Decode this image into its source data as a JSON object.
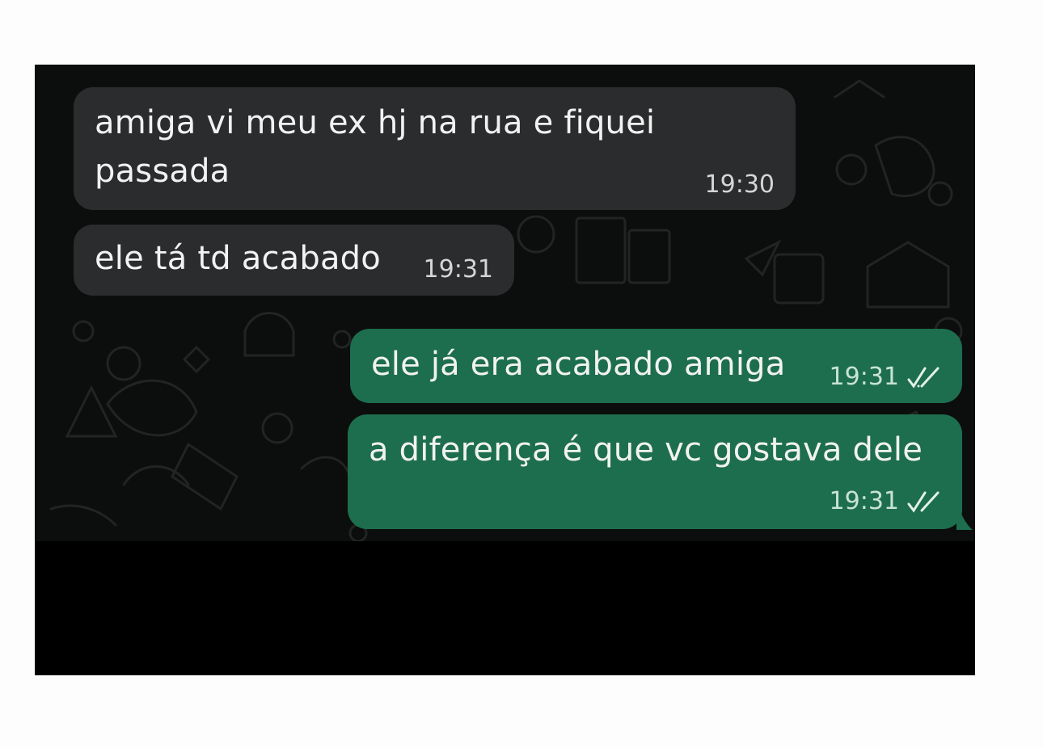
{
  "messages": [
    {
      "direction": "incoming",
      "lines": [
        "amiga vi meu ex hj na rua e fiquei",
        "passada"
      ],
      "time": "19:30"
    },
    {
      "direction": "incoming",
      "lines": [
        "ele tá td acabado"
      ],
      "time": "19:31"
    },
    {
      "direction": "outgoing",
      "lines": [
        "ele já era acabado amiga"
      ],
      "time": "19:31",
      "status": "read"
    },
    {
      "direction": "outgoing",
      "lines": [
        "a diferença é que vc gostava dele"
      ],
      "time": "19:31",
      "status": "read"
    }
  ],
  "colors": {
    "incoming_bubble": "#2a2c2d",
    "outgoing_bubble": "#1d6e4e",
    "chat_background": "#0c0d0d"
  },
  "icons": {
    "read_receipt": "double-check-icon"
  }
}
